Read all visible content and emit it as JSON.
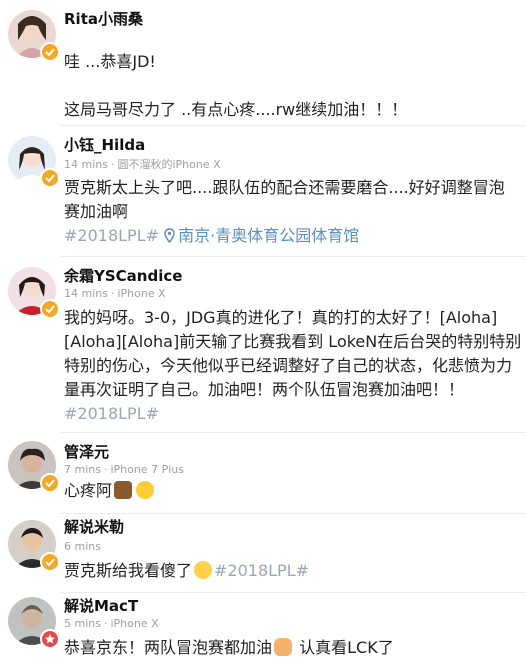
{
  "posts": [
    {
      "name": "Rita小雨桑",
      "lines": [
        "哇 ...恭喜JD!",
        "",
        "这局马哥尽力了 ..有点心疼....rw继续加油！！！"
      ]
    },
    {
      "name": "小钰_Hilda",
      "time": "14 mins",
      "source": "圆不溜秋的iPhone X",
      "lines": [
        "贾克斯太上头了吧....跟队伍的配合还需要磨合....好好调整冒泡",
        "赛加油啊"
      ],
      "hashtag": "#2018LPL#",
      "location": "南京·青奥体育公园体育馆"
    },
    {
      "name": "余霜YSCandice",
      "time": "14 mins",
      "source": "iPhone X",
      "lines": [
        "我的妈呀。3-0，JDG真的进化了！真的打的太好了！[Aloha]",
        "[Aloha][Aloha]前天输了比赛我看到 LokeN在后台哭的特别特别",
        "特别的伤心，今天他似乎已经调整好了自己的状态，化悲愤为力",
        "量再次证明了自己。加油吧！两个队伍冒泡赛加油吧！！"
      ],
      "hashtag": "#2018LPL#"
    },
    {
      "name": "管泽元",
      "time": "7 mins",
      "source": "iPhone 7 Plus",
      "text": "心疼阿",
      "emojis": [
        "horse-emoji",
        "cry-laugh-emoji"
      ]
    },
    {
      "name": "解说米勒",
      "time": "6 mins",
      "text": "贾克斯给我看傻了",
      "emojis": [
        "shocked-emoji"
      ],
      "hashtag": "#2018LPL#"
    },
    {
      "name": "解说MacT",
      "time": "5 mins",
      "source": "iPhone X",
      "text_a": "恭喜京东！两队冒泡赛都加油",
      "emojis": [
        "fist-emoji"
      ],
      "text_b": "认真看LCK了"
    }
  ],
  "dot": "·",
  "colors": {
    "verified": "#f5a623",
    "verified_red": "#e24b4b",
    "hashtag": "#9aa7b8",
    "location": "#5a8fc7"
  }
}
